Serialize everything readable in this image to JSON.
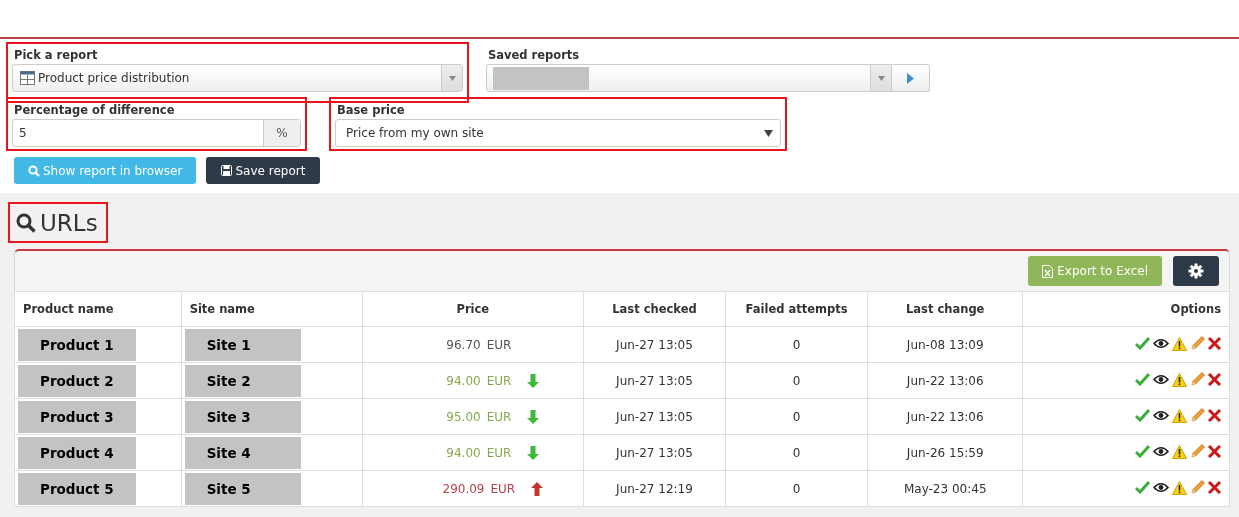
{
  "form": {
    "report": {
      "label": "Pick a report",
      "value": "Product price distribution",
      "highlighted": true
    },
    "saved_reports": {
      "label": "Saved reports",
      "redacted": true
    },
    "percentage": {
      "label": "Percentage of difference",
      "value": "5",
      "unit": "%",
      "highlighted": true
    },
    "base_price": {
      "label": "Base price",
      "value": "Price from my own site",
      "highlighted": true
    },
    "buttons": [
      {
        "kind": "primary",
        "label": "Show report in browser"
      },
      {
        "kind": "dark",
        "label": "Save report"
      }
    ]
  },
  "section": {
    "title": "URLs",
    "highlighted": true
  },
  "toolbar": {
    "export_label": "Export to Excel"
  },
  "table": {
    "columns": [
      "Product name",
      "Site name",
      "Price",
      "Last checked",
      "Failed attempts",
      "Last change",
      "Options"
    ],
    "rows": [
      {
        "product": "Product 1",
        "site": "Site 1",
        "price": "96.70",
        "currency": "EUR",
        "kind": "steady",
        "last_checked": "Jun-27 13:05",
        "failed": "0",
        "last_change": "Jun-08 13:09"
      },
      {
        "product": "Product 2",
        "site": "Site 2",
        "price": "94.00",
        "currency": "EUR",
        "kind": "down",
        "last_checked": "Jun-27 13:05",
        "failed": "0",
        "last_change": "Jun-22 13:06"
      },
      {
        "product": "Product 3",
        "site": "Site 3",
        "price": "95.00",
        "currency": "EUR",
        "kind": "down",
        "last_checked": "Jun-27 13:05",
        "failed": "0",
        "last_change": "Jun-22 13:06"
      },
      {
        "product": "Product 4",
        "site": "Site 4",
        "price": "94.00",
        "currency": "EUR",
        "kind": "down",
        "last_checked": "Jun-27 13:05",
        "failed": "0",
        "last_change": "Jun-26 15:59"
      },
      {
        "product": "Product 5",
        "site": "Site 5",
        "price": "290.09",
        "currency": "EUR",
        "kind": "up",
        "last_checked": "Jun-27 12:19",
        "failed": "0",
        "last_change": "May-23 00:45"
      }
    ]
  }
}
